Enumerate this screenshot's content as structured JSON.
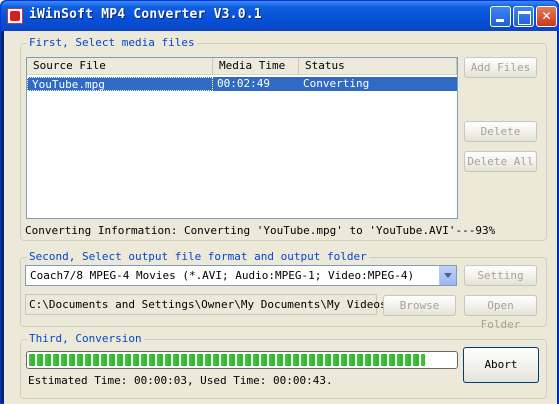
{
  "window": {
    "title": "iWinSoft MP4 Converter V3.0.1"
  },
  "first_group": {
    "title": "First, Select media files",
    "columns": [
      "Source File",
      "Media Time",
      "Status"
    ],
    "rows": [
      {
        "source": "YouTube.mpg",
        "media_time": "00:02:49",
        "status": "Converting"
      }
    ],
    "buttons": {
      "add": "Add Files",
      "delete": "Delete",
      "delete_all": "Delete All"
    },
    "converting_info": "Converting Information: Converting 'YouTube.mpg' to 'YouTube.AVI'---93%"
  },
  "second_group": {
    "title": "Second, Select output file format and output folder",
    "format_selected": "Coach7/8 MPEG-4 Movies (*.AVI; Audio:MPEG-1; Video:MPEG-4)",
    "output_folder": "C:\\Documents and Settings\\Owner\\My Documents\\My Videos",
    "buttons": {
      "setting": "Setting",
      "browse": "Browse",
      "open_folder": "Open Folder"
    }
  },
  "third_group": {
    "title": "Third, Conversion",
    "progress_fraction": 0.93,
    "time_text": "Estimated Time: 00:00:03, Used Time: 00:00:43.",
    "abort_label": "Abort"
  },
  "colors": {
    "title_bar": "#0551d8",
    "group_title": "#0046d5",
    "selection": "#316ac5",
    "progress": "#2fb82a"
  },
  "icons": [
    "app-icon",
    "minimize-icon",
    "maximize-icon",
    "close-icon",
    "dropdown-arrow-icon",
    "mouse-cursor-icon"
  ]
}
